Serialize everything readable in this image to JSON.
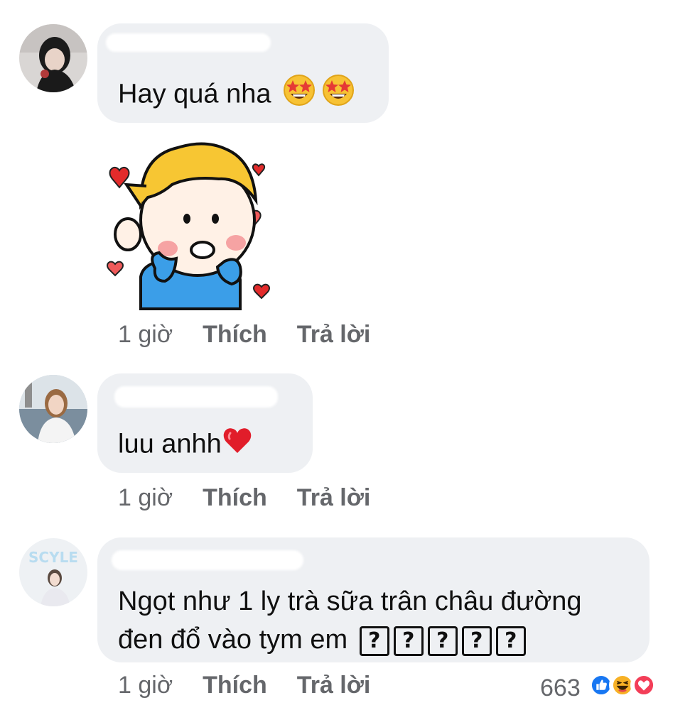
{
  "comments": [
    {
      "text": "Hay quá nha",
      "emoji": [
        "star-struck-face",
        "star-struck-face"
      ],
      "time": "1 giờ",
      "like_label": "Thích",
      "reply_label": "Trả lời",
      "sticker": "boy-with-hearts-sticker"
    },
    {
      "text": "luu anhh",
      "emoji": [
        "red-heart"
      ],
      "time": "1 giờ",
      "like_label": "Thích",
      "reply_label": "Trả lời"
    },
    {
      "text_line1": "Ngọt như 1 ly trà sữa trân châu đường",
      "text_line2": "đen đổ vào tym em",
      "missing_glyph": "?",
      "time": "1 giờ",
      "like_label": "Thích",
      "reply_label": "Trả lời",
      "reaction_count": "663",
      "reactions": [
        "like",
        "haha",
        "love"
      ]
    }
  ],
  "colors": {
    "bubble": "#eef0f3",
    "meta_text": "#65676b",
    "like_blue": "#1877f2",
    "love_red": "#f33e58",
    "haha_yellow": "#f7b125"
  }
}
